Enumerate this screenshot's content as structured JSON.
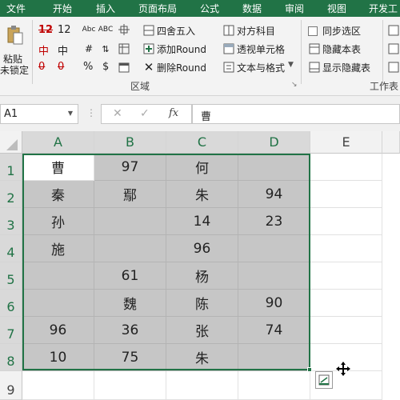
{
  "ribbon_tabs": [
    "文件",
    "开始",
    "插入",
    "页面布局",
    "公式",
    "数据",
    "审阅",
    "视图",
    "开发工"
  ],
  "ribbon": {
    "paste_label": "粘贴",
    "unlock_label": "未锁定",
    "convert_row1": [
      "12",
      "12"
    ],
    "convert_row2": [
      "中",
      "中"
    ],
    "convert_row3": [
      "0",
      "0"
    ],
    "percent": "%",
    "dollar": "$",
    "round_label": "四舍五入",
    "add_round_label": "添加Round",
    "delete_round_label": "删除Round",
    "subject_label": "对方科目",
    "pivot_label": "透视单元格",
    "text_format_label": "文本与格式",
    "group_label": "区域",
    "sync_select_label": "同步选区",
    "hide_sheet_label": "隐藏本表",
    "show_hidden_label": "显示隐藏表",
    "worksheet_group_label": "工作表"
  },
  "formula_bar": {
    "name_box": "A1",
    "fx": "fx",
    "content": "曹"
  },
  "columns": [
    "A",
    "B",
    "C",
    "D",
    "E"
  ],
  "rows": [
    "1",
    "2",
    "3",
    "4",
    "5",
    "6",
    "7",
    "8",
    "9"
  ],
  "cells": [
    [
      "曹",
      "97",
      "何",
      ""
    ],
    [
      "秦",
      "鄢",
      "朱",
      "94"
    ],
    [
      "孙",
      "",
      "14",
      "23"
    ],
    [
      "施",
      "",
      "96",
      ""
    ],
    [
      "",
      "61",
      "杨",
      ""
    ],
    [
      "",
      "魏",
      "陈",
      "90"
    ],
    [
      "96",
      "36",
      "张",
      "74"
    ],
    [
      "10",
      "75",
      "朱",
      ""
    ]
  ],
  "colors": {
    "excel_green": "#217346",
    "selection_fill": "#c6c6c6",
    "red_icon": "#c00000"
  }
}
